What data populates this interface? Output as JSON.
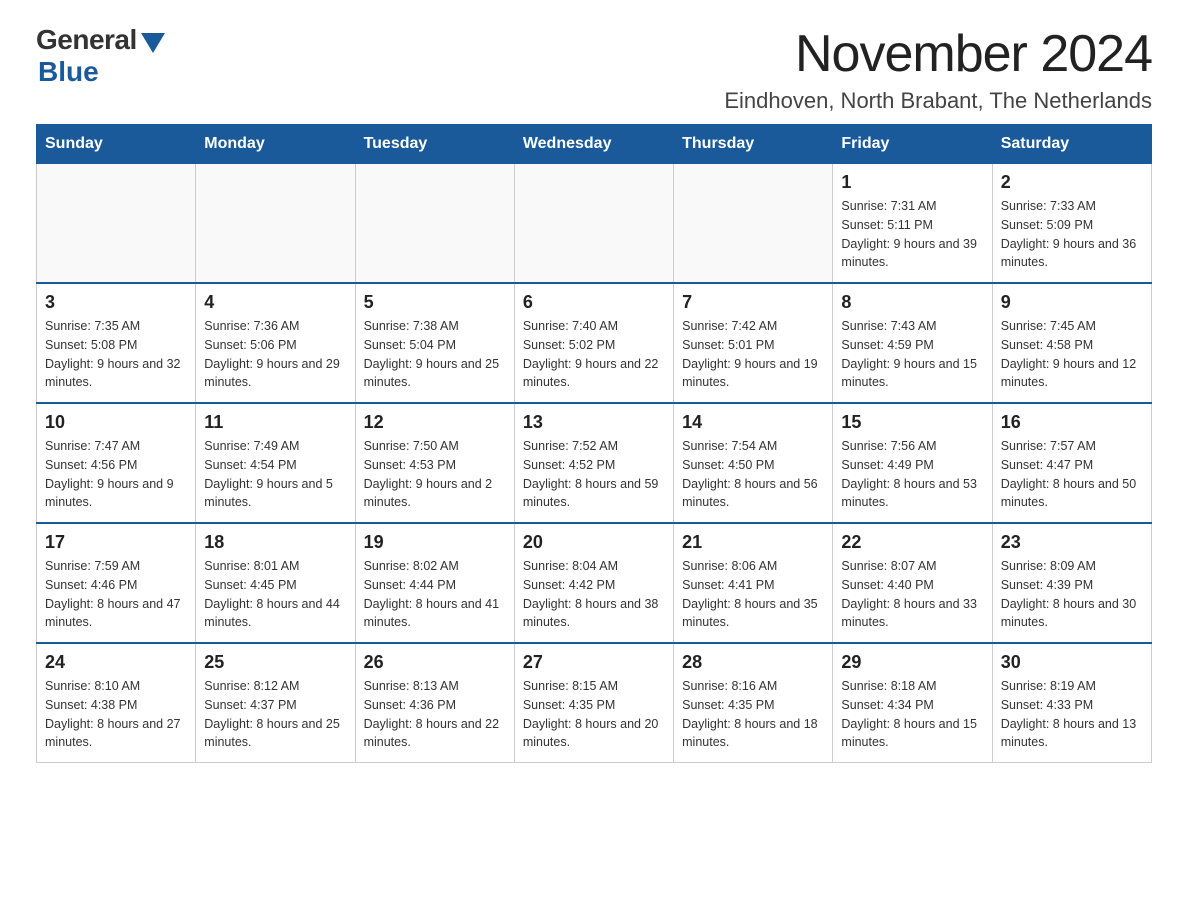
{
  "header": {
    "logo_general": "General",
    "logo_blue": "Blue",
    "title": "November 2024",
    "subtitle": "Eindhoven, North Brabant, The Netherlands"
  },
  "days_of_week": [
    "Sunday",
    "Monday",
    "Tuesday",
    "Wednesday",
    "Thursday",
    "Friday",
    "Saturday"
  ],
  "weeks": [
    [
      {
        "day": "",
        "info": ""
      },
      {
        "day": "",
        "info": ""
      },
      {
        "day": "",
        "info": ""
      },
      {
        "day": "",
        "info": ""
      },
      {
        "day": "",
        "info": ""
      },
      {
        "day": "1",
        "info": "Sunrise: 7:31 AM\nSunset: 5:11 PM\nDaylight: 9 hours and 39 minutes."
      },
      {
        "day": "2",
        "info": "Sunrise: 7:33 AM\nSunset: 5:09 PM\nDaylight: 9 hours and 36 minutes."
      }
    ],
    [
      {
        "day": "3",
        "info": "Sunrise: 7:35 AM\nSunset: 5:08 PM\nDaylight: 9 hours and 32 minutes."
      },
      {
        "day": "4",
        "info": "Sunrise: 7:36 AM\nSunset: 5:06 PM\nDaylight: 9 hours and 29 minutes."
      },
      {
        "day": "5",
        "info": "Sunrise: 7:38 AM\nSunset: 5:04 PM\nDaylight: 9 hours and 25 minutes."
      },
      {
        "day": "6",
        "info": "Sunrise: 7:40 AM\nSunset: 5:02 PM\nDaylight: 9 hours and 22 minutes."
      },
      {
        "day": "7",
        "info": "Sunrise: 7:42 AM\nSunset: 5:01 PM\nDaylight: 9 hours and 19 minutes."
      },
      {
        "day": "8",
        "info": "Sunrise: 7:43 AM\nSunset: 4:59 PM\nDaylight: 9 hours and 15 minutes."
      },
      {
        "day": "9",
        "info": "Sunrise: 7:45 AM\nSunset: 4:58 PM\nDaylight: 9 hours and 12 minutes."
      }
    ],
    [
      {
        "day": "10",
        "info": "Sunrise: 7:47 AM\nSunset: 4:56 PM\nDaylight: 9 hours and 9 minutes."
      },
      {
        "day": "11",
        "info": "Sunrise: 7:49 AM\nSunset: 4:54 PM\nDaylight: 9 hours and 5 minutes."
      },
      {
        "day": "12",
        "info": "Sunrise: 7:50 AM\nSunset: 4:53 PM\nDaylight: 9 hours and 2 minutes."
      },
      {
        "day": "13",
        "info": "Sunrise: 7:52 AM\nSunset: 4:52 PM\nDaylight: 8 hours and 59 minutes."
      },
      {
        "day": "14",
        "info": "Sunrise: 7:54 AM\nSunset: 4:50 PM\nDaylight: 8 hours and 56 minutes."
      },
      {
        "day": "15",
        "info": "Sunrise: 7:56 AM\nSunset: 4:49 PM\nDaylight: 8 hours and 53 minutes."
      },
      {
        "day": "16",
        "info": "Sunrise: 7:57 AM\nSunset: 4:47 PM\nDaylight: 8 hours and 50 minutes."
      }
    ],
    [
      {
        "day": "17",
        "info": "Sunrise: 7:59 AM\nSunset: 4:46 PM\nDaylight: 8 hours and 47 minutes."
      },
      {
        "day": "18",
        "info": "Sunrise: 8:01 AM\nSunset: 4:45 PM\nDaylight: 8 hours and 44 minutes."
      },
      {
        "day": "19",
        "info": "Sunrise: 8:02 AM\nSunset: 4:44 PM\nDaylight: 8 hours and 41 minutes."
      },
      {
        "day": "20",
        "info": "Sunrise: 8:04 AM\nSunset: 4:42 PM\nDaylight: 8 hours and 38 minutes."
      },
      {
        "day": "21",
        "info": "Sunrise: 8:06 AM\nSunset: 4:41 PM\nDaylight: 8 hours and 35 minutes."
      },
      {
        "day": "22",
        "info": "Sunrise: 8:07 AM\nSunset: 4:40 PM\nDaylight: 8 hours and 33 minutes."
      },
      {
        "day": "23",
        "info": "Sunrise: 8:09 AM\nSunset: 4:39 PM\nDaylight: 8 hours and 30 minutes."
      }
    ],
    [
      {
        "day": "24",
        "info": "Sunrise: 8:10 AM\nSunset: 4:38 PM\nDaylight: 8 hours and 27 minutes."
      },
      {
        "day": "25",
        "info": "Sunrise: 8:12 AM\nSunset: 4:37 PM\nDaylight: 8 hours and 25 minutes."
      },
      {
        "day": "26",
        "info": "Sunrise: 8:13 AM\nSunset: 4:36 PM\nDaylight: 8 hours and 22 minutes."
      },
      {
        "day": "27",
        "info": "Sunrise: 8:15 AM\nSunset: 4:35 PM\nDaylight: 8 hours and 20 minutes."
      },
      {
        "day": "28",
        "info": "Sunrise: 8:16 AM\nSunset: 4:35 PM\nDaylight: 8 hours and 18 minutes."
      },
      {
        "day": "29",
        "info": "Sunrise: 8:18 AM\nSunset: 4:34 PM\nDaylight: 8 hours and 15 minutes."
      },
      {
        "day": "30",
        "info": "Sunrise: 8:19 AM\nSunset: 4:33 PM\nDaylight: 8 hours and 13 minutes."
      }
    ]
  ]
}
